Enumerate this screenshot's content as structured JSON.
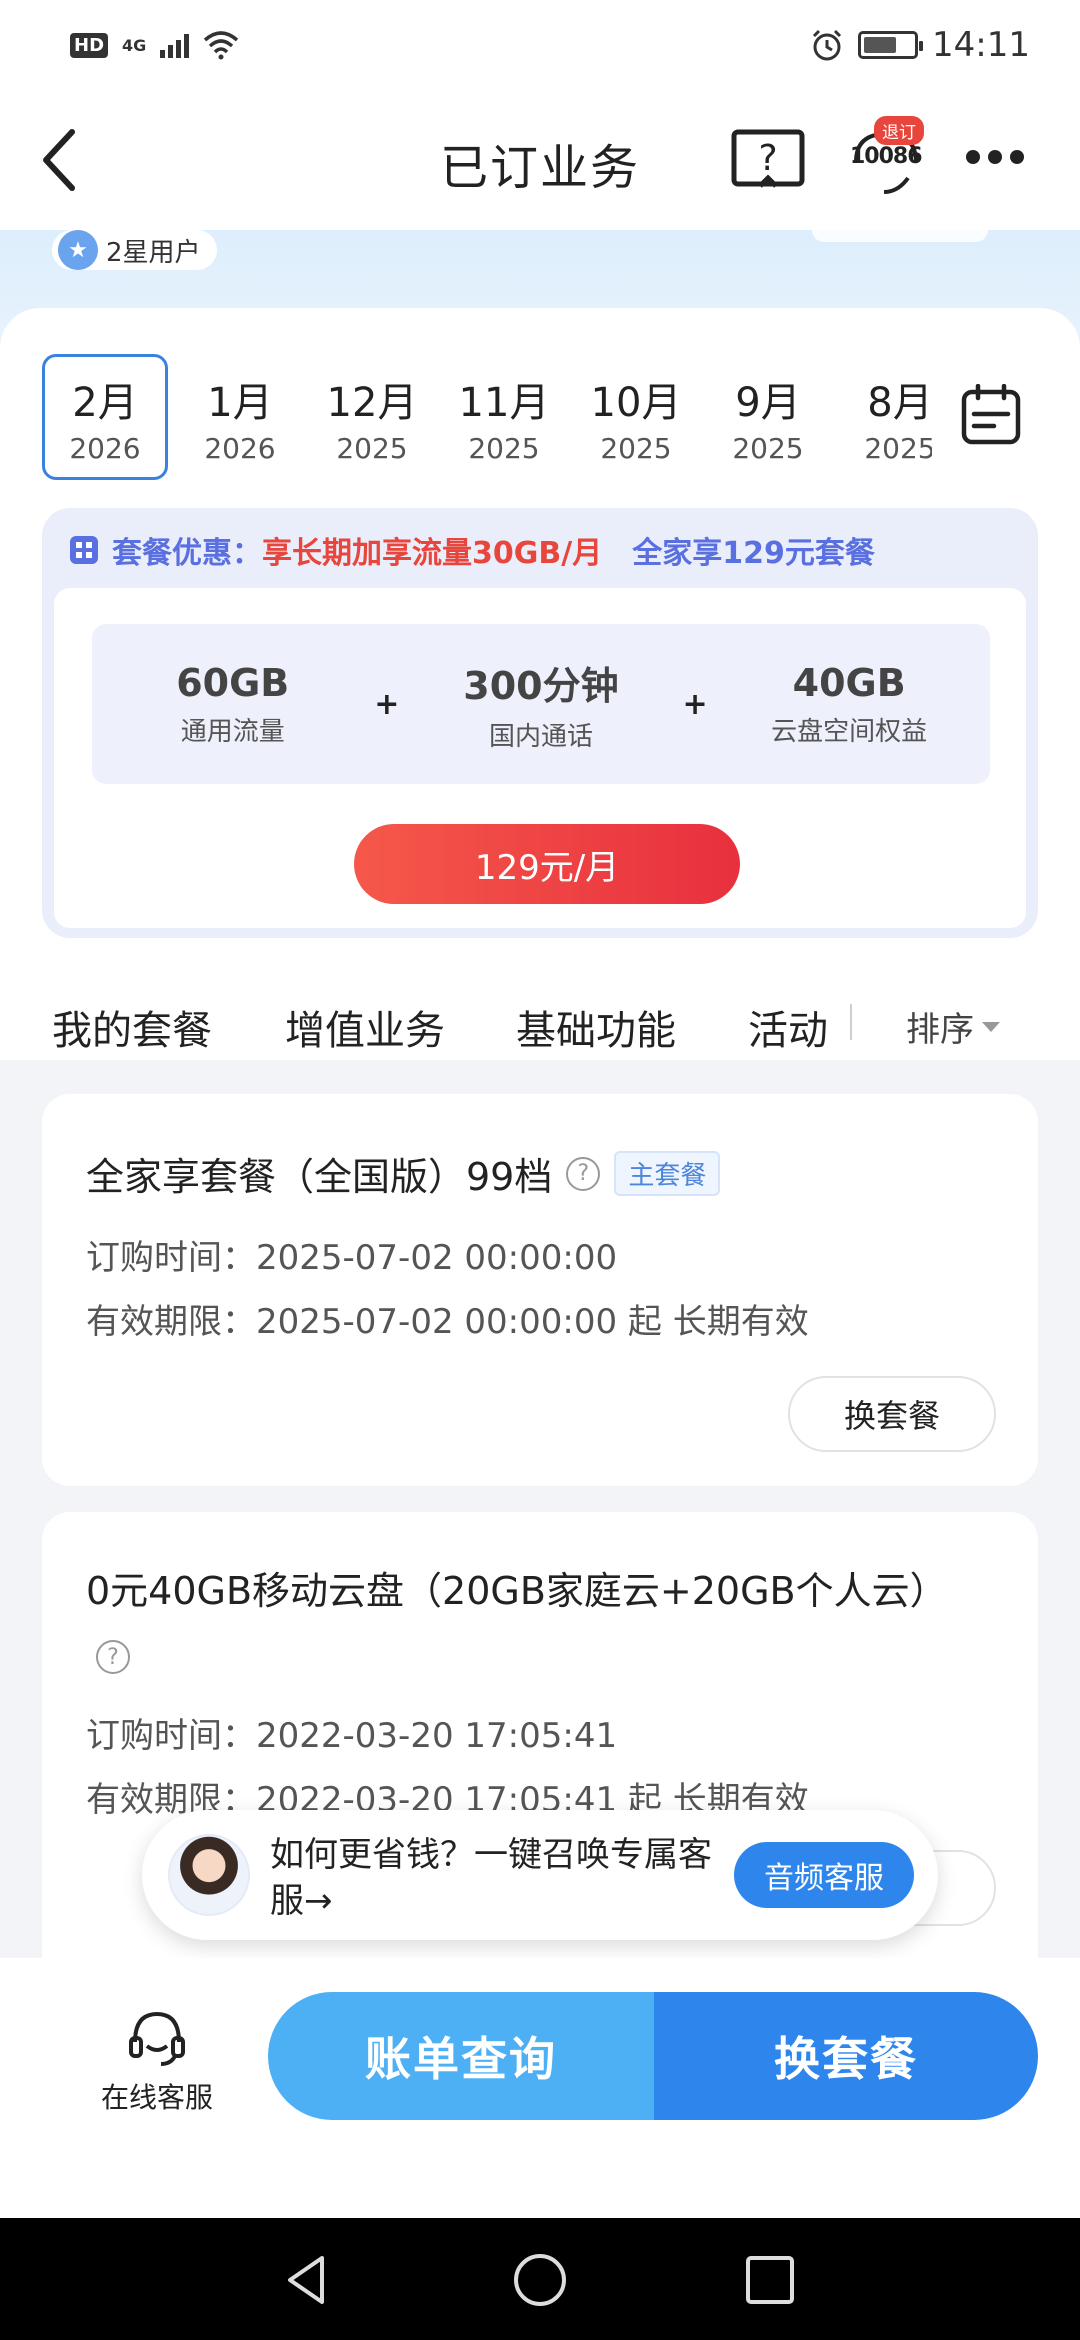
{
  "status_bar": {
    "hd": "HD",
    "network": "4G",
    "time": "14:11"
  },
  "nav": {
    "title": "已订业务",
    "cs_number": "10086",
    "cs_tag": "退订"
  },
  "hero": {
    "user_level": "2星用户"
  },
  "months": [
    {
      "month": "2月",
      "year": "2026",
      "active": true
    },
    {
      "month": "1月",
      "year": "2026",
      "active": false
    },
    {
      "month": "12月",
      "year": "2025",
      "active": false
    },
    {
      "month": "11月",
      "year": "2025",
      "active": false
    },
    {
      "month": "10月",
      "year": "2025",
      "active": false
    },
    {
      "month": "9月",
      "year": "2025",
      "active": false
    },
    {
      "month": "8月",
      "year": "2025",
      "active": false
    }
  ],
  "promo": {
    "label": "套餐优惠：",
    "highlight": "享长期加享流量30GB/月",
    "plan": "全家享129元套餐",
    "quotas": [
      {
        "value": "60GB",
        "label": "通用流量"
      },
      {
        "value": "300分钟",
        "label": "国内通话"
      },
      {
        "value": "40GB",
        "label": "云盘空间权益"
      }
    ],
    "plus": "+",
    "price": "129元/月"
  },
  "tabs": {
    "items": [
      "我的套餐",
      "增值业务",
      "基础功能",
      "活动"
    ],
    "sort": "排序"
  },
  "packages": [
    {
      "title": "全家享套餐（全国版）99档",
      "tag": "主套餐",
      "order_label": "订购时间：",
      "order_time": "2025-07-02 00:00:00",
      "valid_label": "有效期限：",
      "valid_time": "2025-07-02 00:00:00 起 长期有效",
      "action": "换套餐"
    },
    {
      "title": "0元40GB移动云盘（20GB家庭云+20GB个人云）",
      "order_label": "订购时间：",
      "order_time": "2022-03-20 17:05:41",
      "valid_label": "有效期限：",
      "valid_time": "2022-03-20 17:05:41 起 长期有效"
    }
  ],
  "floater": {
    "text": "如何更省钱？一键召唤专属客服→",
    "button": "音频客服"
  },
  "bottom": {
    "online_cs": "在线客服",
    "bill": "账单查询",
    "change": "换套餐"
  },
  "colors": {
    "accent_blue": "#2e86ec",
    "light_blue": "#4db0f4",
    "promo_red": "#e8453c",
    "promo_purple": "#5a6fe0"
  }
}
